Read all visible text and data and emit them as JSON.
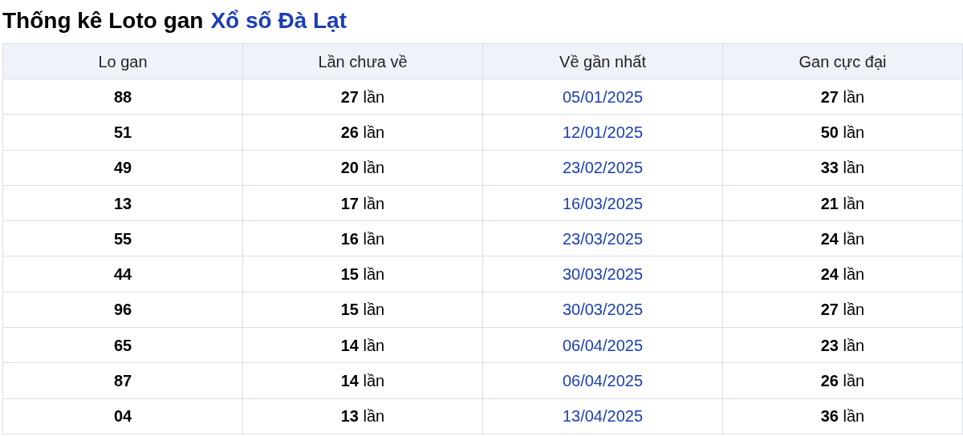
{
  "title": {
    "text": "Thống kê Loto gan",
    "link": "Xổ số Đà Lạt"
  },
  "table": {
    "columns": [
      "Lo gan",
      "Lần chưa về",
      "Về gần nhất",
      "Gan cực đại"
    ],
    "rows": [
      [
        "88",
        "**27** lần",
        "05/01/2025",
        "**27** lần"
      ],
      [
        "51",
        "**26** lần",
        "12/01/2025",
        "**50** lần"
      ],
      [
        "49",
        "**20** lần",
        "23/02/2025",
        "**33** lần"
      ],
      [
        "13",
        "**17** lần",
        "16/03/2025",
        "**21** lần"
      ],
      [
        "55",
        "**16** lần",
        "23/03/2025",
        "**24** lần"
      ],
      [
        "44",
        "**15** lần",
        "30/03/2025",
        "**24** lần"
      ],
      [
        "96",
        "**15** lần",
        "30/03/2025",
        "**27** lần"
      ],
      [
        "65",
        "**14** lần",
        "06/04/2025",
        "**23** lần"
      ],
      [
        "87",
        "**14** lần",
        "06/04/2025",
        "**26** lần"
      ],
      [
        "04",
        "**13** lần",
        "13/04/2025",
        "**36** lần"
      ]
    ]
  }
}
